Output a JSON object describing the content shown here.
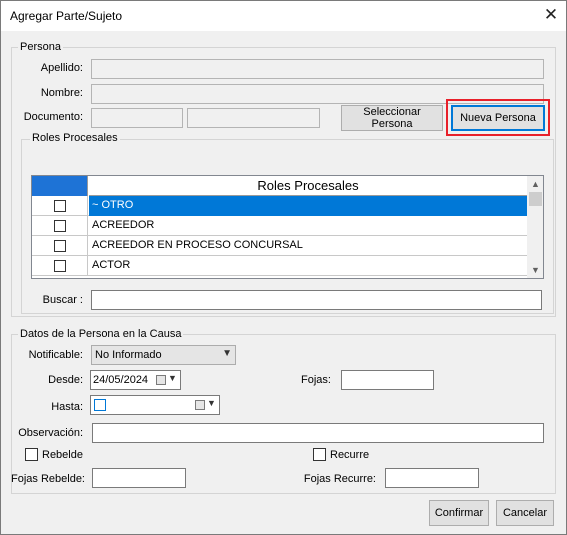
{
  "window": {
    "title": "Agregar Parte/Sujeto",
    "close_glyph": "✕"
  },
  "persona": {
    "legend": "Persona",
    "apellido_label": "Apellido:",
    "nombre_label": "Nombre:",
    "documento_label": "Documento:",
    "apellido_value": "",
    "nombre_value": "",
    "documento_value1": "",
    "documento_value2": "",
    "seleccionar_label": "Seleccionar Persona",
    "nueva_label": "Nueva Persona"
  },
  "roles": {
    "legend": "Roles Procesales",
    "column_header": "Roles Procesales",
    "rows": [
      {
        "text": "~ OTRO",
        "selected": true,
        "checked": false
      },
      {
        "text": "ACREEDOR",
        "selected": false,
        "checked": false
      },
      {
        "text": "ACREEDOR EN PROCESO CONCURSAL",
        "selected": false,
        "checked": false
      },
      {
        "text": "ACTOR",
        "selected": false,
        "checked": false
      }
    ],
    "buscar_label": "Buscar :",
    "buscar_value": "",
    "scroll_up_glyph": "▲",
    "scroll_down_glyph": "▼"
  },
  "datos": {
    "legend": "Datos de la Persona en la Causa",
    "notificable_label": "Notificable:",
    "notificable_value": "No Informado",
    "desde_label": "Desde:",
    "desde_value": "24/05/2024",
    "hasta_label": "Hasta:",
    "hasta_value": "",
    "fojas_label": "Fojas:",
    "fojas_value": "",
    "observacion_label": "Observación:",
    "observacion_value": "",
    "rebelde_label": "Rebelde",
    "recurre_label": "Recurre",
    "fojas_rebelde_label": "Fojas Rebelde:",
    "fojas_rebelde_value": "",
    "fojas_recurre_label": "Fojas Recurre:",
    "fojas_recurre_value": "",
    "dropdown_glyph": "▼"
  },
  "footer": {
    "confirmar_label": "Confirmar",
    "cancelar_label": "Cancelar"
  },
  "colors": {
    "selection": "#0078d7",
    "highlight": "#e8202a",
    "header_check": "#1e73d6"
  }
}
